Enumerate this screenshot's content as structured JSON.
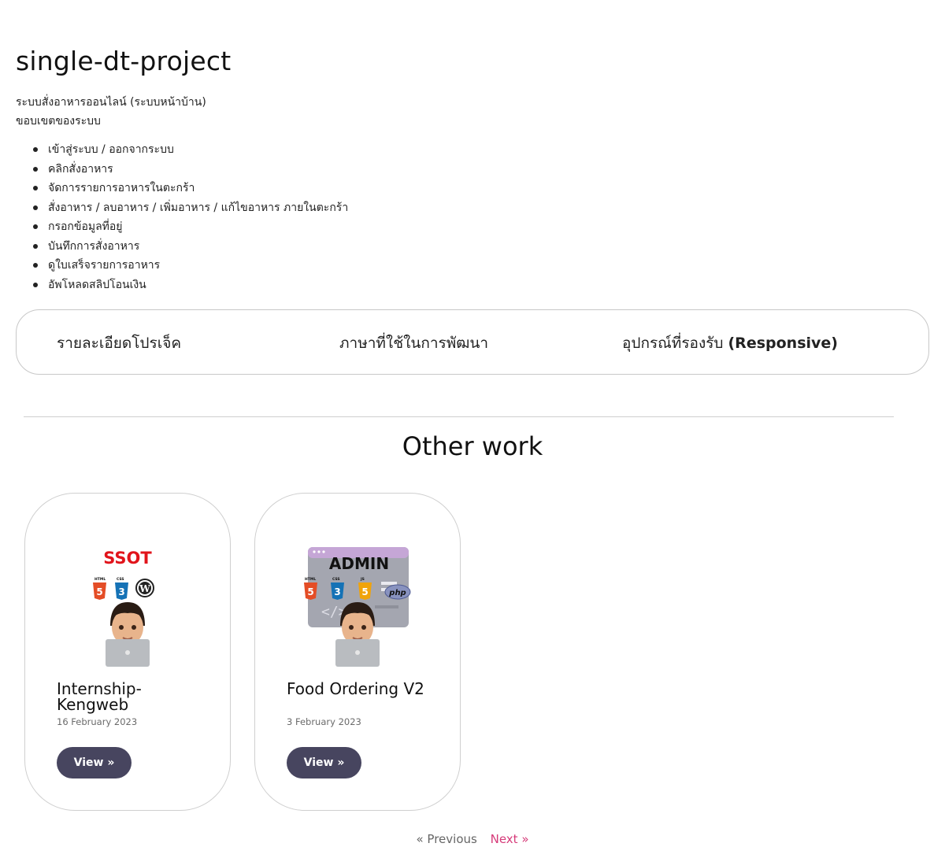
{
  "page": {
    "title": "single-dt-project",
    "intro_line1": "ระบบสั่งอาหารออนไลน์ (ระบบหน้าบ้าน)",
    "intro_line2": "ขอบเขตของระบบ",
    "scope_items": [
      "เข้าสู่ระบบ / ออกจากระบบ",
      "คลิกสั่งอาหาร",
      "จัดการรายการอาหารในตะกร้า",
      "สั่งอาหาร / ลบอาหาร / เพิ่มอาหาร / แก้ไขอาหาร ภายในตะกร้า",
      "กรอกข้อมูลที่อยู่",
      "บันทึกการสั่งอาหาร",
      "ดูใบเสร็จรายการอาหาร",
      "อัพโหลดสลิปโอนเงิน"
    ]
  },
  "tabs": {
    "details": "รายละเอียดโปรเจ็ค",
    "languages": "ภาษาที่ใช้ในการพัฒนา",
    "devices": "อุปกรณ์ที่รองรับ",
    "devices_bold": "(Responsive)"
  },
  "other_work": {
    "heading": "Other work",
    "cards": [
      {
        "title": "Internship-Kengweb",
        "date": "16 February 2023",
        "button": "View »",
        "thumb_text": "SSOT",
        "icons": [
          "html5-icon",
          "css3-icon",
          "wordpress-icon",
          "memoji-laptop"
        ]
      },
      {
        "title": "Food Ordering V2",
        "date": "3 February 2023",
        "button": "View »",
        "thumb_text": "ADMIN",
        "thumb_badge": "php",
        "icons": [
          "html5-icon",
          "css3-icon",
          "js-icon",
          "php-icon",
          "memoji-laptop"
        ]
      }
    ]
  },
  "pagination": {
    "previous": "« Previous",
    "next": "Next »"
  },
  "colors": {
    "button_bg": "#47455f",
    "next_link": "#d63c7a",
    "html5": "#e44d26",
    "css3": "#1572b6",
    "js": "#f0a30a"
  }
}
